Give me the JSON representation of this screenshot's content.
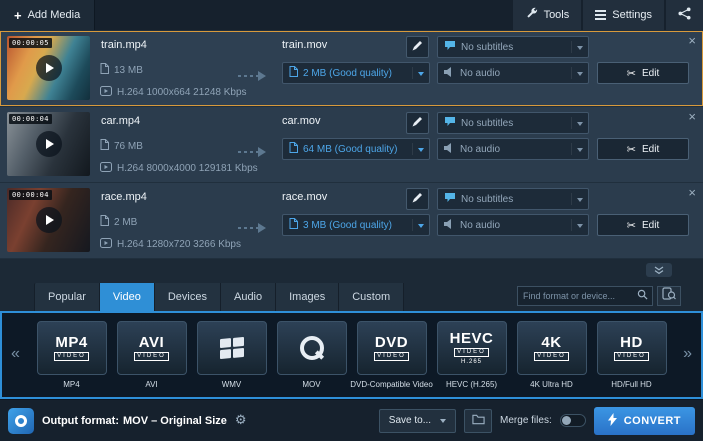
{
  "topbar": {
    "add_media_label": "Add Media",
    "tools_label": "Tools",
    "settings_label": "Settings"
  },
  "media_rows": [
    {
      "duration": "00:00:05",
      "source_name": "train.mp4",
      "source_size": "13 MB",
      "source_codec": "H.264 1000x664 21248 Kbps",
      "output_name": "train.mov",
      "output_quality": "2 MB (Good quality)",
      "subtitles": "No subtitles",
      "audio": "No audio",
      "edit": "Edit",
      "selected": true
    },
    {
      "duration": "00:00:04",
      "source_name": "car.mp4",
      "source_size": "76 MB",
      "source_codec": "H.264 8000x4000 129181 Kbps",
      "output_name": "car.mov",
      "output_quality": "64 MB (Good quality)",
      "subtitles": "No subtitles",
      "audio": "No audio",
      "edit": "Edit",
      "selected": false
    },
    {
      "duration": "00:00:04",
      "source_name": "race.mp4",
      "source_size": "2 MB",
      "source_codec": "H.264 1280x720 3266 Kbps",
      "output_name": "race.mov",
      "output_quality": "3 MB (Good quality)",
      "subtitles": "No subtitles",
      "audio": "No audio",
      "edit": "Edit",
      "selected": false
    }
  ],
  "format_panel": {
    "tabs": [
      {
        "label": "Popular",
        "active": false
      },
      {
        "label": "Video",
        "active": true
      },
      {
        "label": "Devices",
        "active": false
      },
      {
        "label": "Audio",
        "active": false
      },
      {
        "label": "Images",
        "active": false
      },
      {
        "label": "Custom",
        "active": false
      }
    ],
    "search_placeholder": "Find format or device...",
    "formats": [
      {
        "label": "MP4",
        "logo_main": "MP4",
        "logo_sub": "VIDEO"
      },
      {
        "label": "AVI",
        "logo_main": "AVI",
        "logo_sub": "VIDEO"
      },
      {
        "label": "WMV",
        "logo_icon": "windows-logo"
      },
      {
        "label": "MOV",
        "logo_icon": "quicktime-logo"
      },
      {
        "label": "DVD-Compatible Video",
        "logo_main": "DVD",
        "logo_sub": "VIDEO"
      },
      {
        "label": "HEVC (H.265)",
        "logo_main": "HEVC",
        "logo_sub": "VIDEO",
        "logo_extra": "H.265"
      },
      {
        "label": "4K Ultra HD",
        "logo_main": "4K",
        "logo_sub": "VIDEO"
      },
      {
        "label": "HD/Full HD",
        "logo_main": "HD",
        "logo_sub": "VIDEO"
      }
    ]
  },
  "bottombar": {
    "output_format_label": "Output format:",
    "output_format_value": "MOV – Original Size",
    "save_to": "Save to...",
    "merge_label": "Merge files:",
    "convert": "CONVERT"
  },
  "colors": {
    "accent_blue": "#2f8fd6",
    "selected_row_border": "#d89a3c",
    "link_blue": "#4da6e8"
  }
}
